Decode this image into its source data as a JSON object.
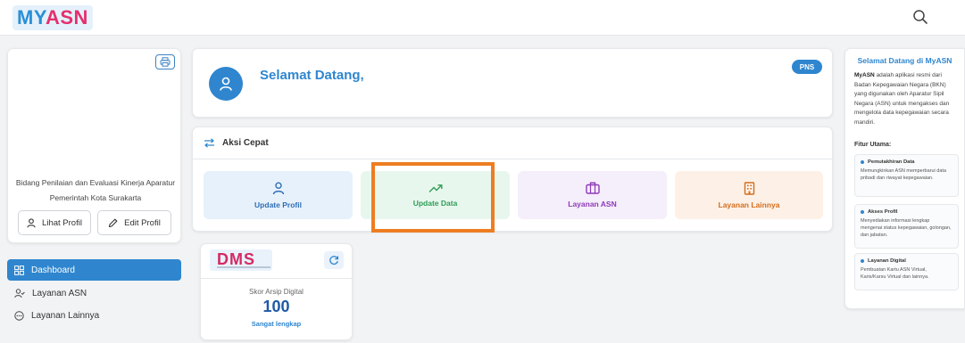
{
  "header": {
    "logo_part1": "MY",
    "logo_part2": "ASN",
    "search_icon": "search-icon"
  },
  "profile": {
    "org_name": "Bidang Penilaian dan Evaluasi Kinerja Aparatur Pemerintah Kota Surakarta",
    "view_profile_label": "Lihat Profil",
    "edit_profile_label": "Edit Profil"
  },
  "sidebar": {
    "items": [
      {
        "label": "Dashboard",
        "icon": "grid-icon",
        "active": true
      },
      {
        "label": "Layanan ASN",
        "icon": "user-check-icon",
        "active": false
      },
      {
        "label": "Layanan Lainnya",
        "icon": "more-circle-icon",
        "active": false
      }
    ]
  },
  "welcome": {
    "title": "Selamat Datang,",
    "badge": "PNS"
  },
  "quick_actions": {
    "title": "Aksi Cepat",
    "items": [
      {
        "label": "Update Profil",
        "icon": "user-icon",
        "color": "#2f6fb6"
      },
      {
        "label": "Update Data",
        "icon": "trending-up-icon",
        "color": "#2f9e56"
      },
      {
        "label": "Layanan ASN",
        "icon": "briefcase-icon",
        "color": "#8e3bb8"
      },
      {
        "label": "Layanan Lainnya",
        "icon": "building-icon",
        "color": "#d46d1c"
      }
    ]
  },
  "dms": {
    "logo": "DMS",
    "score_label": "Skor Arsip Digital",
    "score_value": "100",
    "score_status": "Sangat lengkap"
  },
  "info_panel": {
    "title": "Selamat Datang di MyASN",
    "brand": "MyASN",
    "description": " adalah aplikasi resmi dari Badan Kepegawaian Negara (BKN) yang digunakan oleh Aparatur Sipil Negara (ASN) untuk mengakses dan mengelola data kepegawaian secara mandiri.",
    "features_title": "Fitur Utama:",
    "features": [
      {
        "title": "Pemutakhiran Data",
        "desc": "Memungkinkan ASN memperbarui data pribadi dan riwayat kepegawaian."
      },
      {
        "title": "Akses Profil",
        "desc": "Menyediakan informasi lengkap mengenai status kepegawaian, golongan, dan jabatan."
      },
      {
        "title": "Layanan Digital",
        "desc": "Pembuatan Kartu ASN Virtual, Karis/Karsu Virtual dan lainnya."
      }
    ]
  },
  "colors": {
    "primary": "#2f86cf",
    "brand_pink": "#e5306e",
    "highlight": "#ee7d22"
  }
}
